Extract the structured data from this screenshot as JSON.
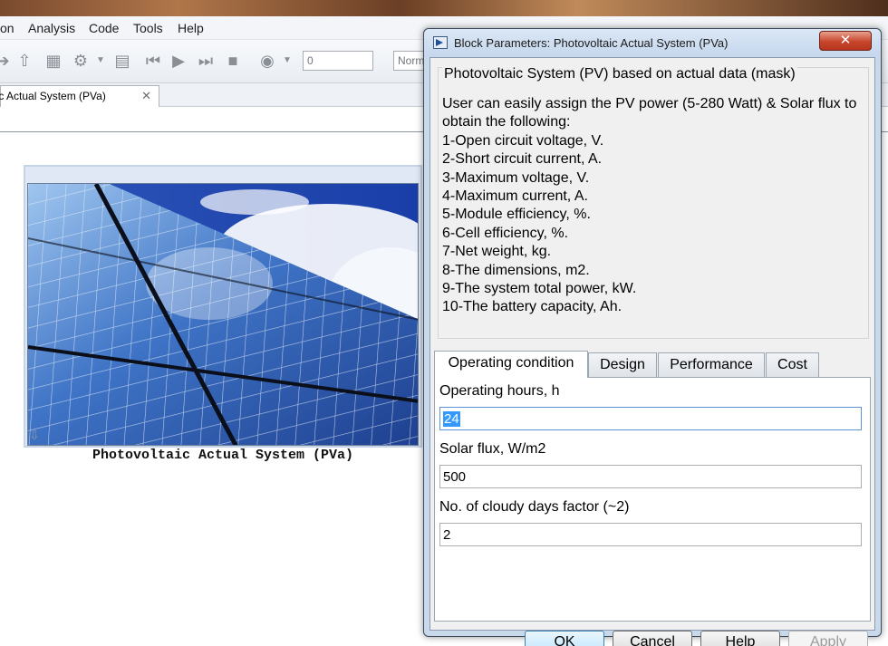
{
  "menubar": {
    "items": [
      "on",
      "Analysis",
      "Code",
      "Tools",
      "Help"
    ]
  },
  "toolbar": {
    "sim_time_value": "0",
    "sim_mode_value": "Norm"
  },
  "model_tab": {
    "label": "aic Actual System (PVa)",
    "close": "✕"
  },
  "block": {
    "caption": "Photovoltaic Actual System (PVa)"
  },
  "dialog": {
    "title": "Block Parameters: Photovoltaic Actual System (PVa)",
    "close_glyph": "✕",
    "group_title": "Photovoltaic System (PV) based on actual data (mask)",
    "description": [
      "User can easily assign the PV power (5-280 Watt) & Solar flux to",
      "obtain the following:",
      "1-Open circuit voltage, V.",
      "2-Short circuit current, A.",
      "3-Maximum voltage, V.",
      "4-Maximum current, A.",
      "5-Module efficiency, %.",
      "6-Cell efficiency, %.",
      "7-Net weight, kg.",
      "8-The dimensions, m2.",
      "9-The system total power, kW.",
      "10-The battery capacity, Ah."
    ],
    "tabs": [
      "Operating condition",
      "Design",
      "Performance",
      "Cost"
    ],
    "active_tab": "Operating condition",
    "fields": [
      {
        "label": "Operating hours, h",
        "value": "24"
      },
      {
        "label": "Solar flux, W/m2",
        "value": "500"
      },
      {
        "label": "No. of cloudy days factor (~2)",
        "value": "2"
      }
    ],
    "buttons": {
      "ok": "OK",
      "cancel": "Cancel",
      "help": "Help",
      "apply": "Apply"
    }
  },
  "colors": {
    "selection": "#3399ff",
    "dialog_frame": "#c9d9ec",
    "close_button": "#c6452c"
  }
}
